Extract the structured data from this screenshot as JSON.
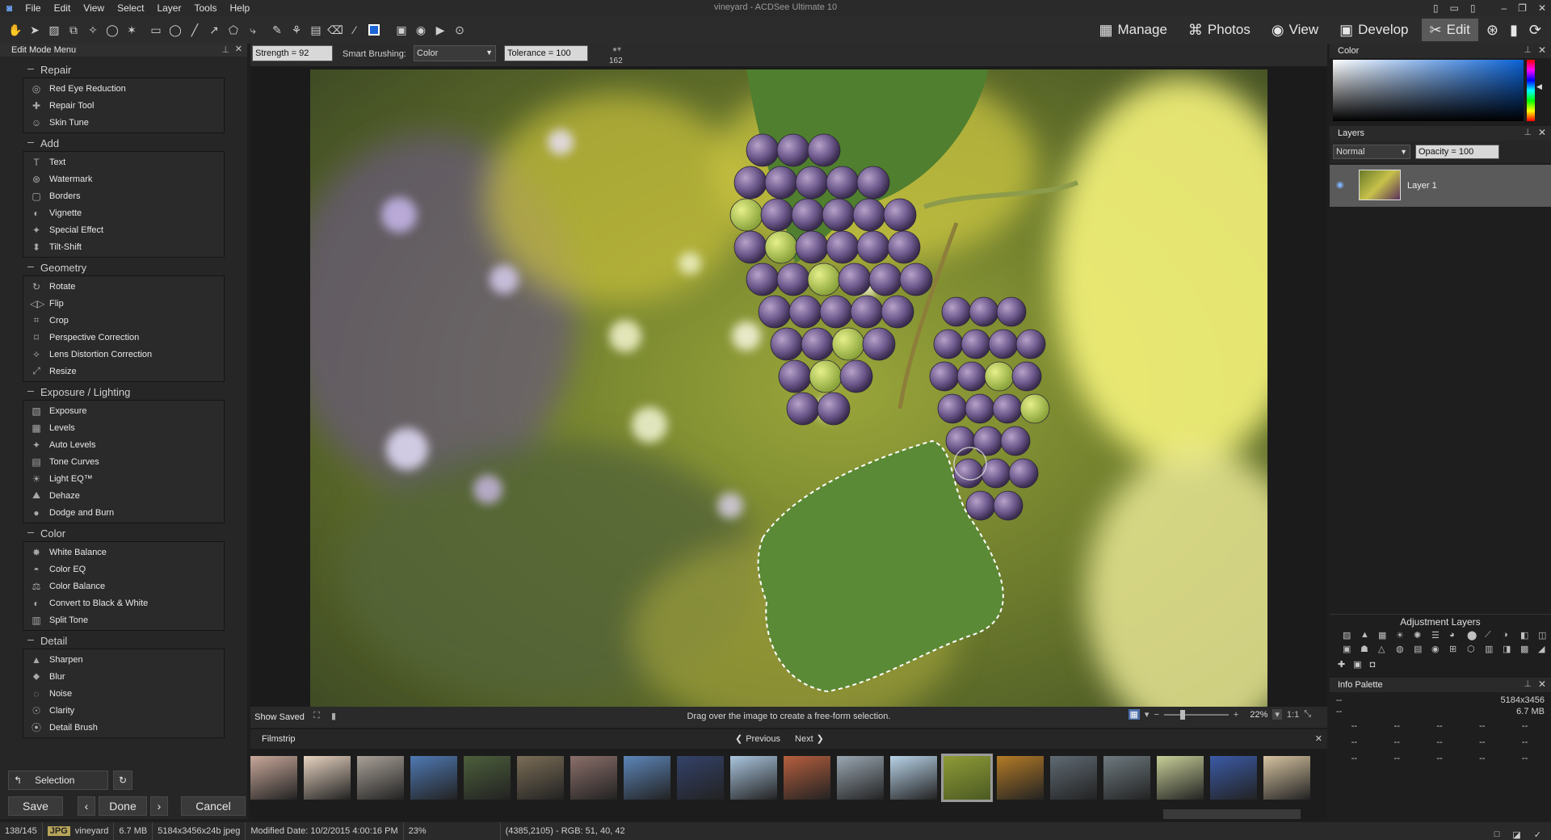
{
  "app": {
    "title": "vineyard - ACDSee Ultimate 10",
    "menu": [
      "File",
      "Edit",
      "View",
      "Select",
      "Layer",
      "Tools",
      "Help"
    ]
  },
  "modes": [
    {
      "label": "Manage",
      "icon": "grid-icon"
    },
    {
      "label": "Photos",
      "icon": "photos-icon"
    },
    {
      "label": "View",
      "icon": "eye-icon"
    },
    {
      "label": "Develop",
      "icon": "develop-icon"
    },
    {
      "label": "Edit",
      "icon": "edit-icon",
      "active": true
    }
  ],
  "left": {
    "title": "Edit Mode Menu",
    "groups": [
      {
        "name": "Repair",
        "items": [
          "Red Eye Reduction",
          "Repair Tool",
          "Skin Tune"
        ]
      },
      {
        "name": "Add",
        "items": [
          "Text",
          "Watermark",
          "Borders",
          "Vignette",
          "Special Effect",
          "Tilt-Shift"
        ]
      },
      {
        "name": "Geometry",
        "items": [
          "Rotate",
          "Flip",
          "Crop",
          "Perspective Correction",
          "Lens Distortion Correction",
          "Resize"
        ]
      },
      {
        "name": "Exposure / Lighting",
        "items": [
          "Exposure",
          "Levels",
          "Auto Levels",
          "Tone Curves",
          "Light EQ™",
          "Dehaze",
          "Dodge and Burn"
        ]
      },
      {
        "name": "Color",
        "items": [
          "White Balance",
          "Color EQ",
          "Color Balance",
          "Convert to Black & White",
          "Split Tone"
        ]
      },
      {
        "name": "Detail",
        "items": [
          "Sharpen",
          "Blur",
          "Noise",
          "Clarity",
          "Detail Brush"
        ]
      }
    ],
    "selection_label": "Selection",
    "save_label": "Save",
    "done_label": "Done",
    "cancel_label": "Cancel"
  },
  "options": {
    "strength": "Strength = 92",
    "smart_brushing_label": "Smart Brushing:",
    "smart_brushing_value": "Color",
    "tolerance": "Tolerance = 100",
    "brush_size": "162"
  },
  "canvas": {
    "show_saved": "Show Saved",
    "hint": "Drag over the image to create a free-form selection.",
    "zoom": "22%",
    "ratio": "1:1"
  },
  "filmstrip": {
    "title": "Filmstrip",
    "previous": "Previous",
    "next": "Next",
    "thumb_colors": [
      "#c9a89a",
      "#e7d3c0",
      "#a9a198",
      "#4f79b3",
      "#4c5f3b",
      "#7b6d56",
      "#8b6f6a",
      "#5d86b9",
      "#34426a",
      "#aac5de",
      "#b65f3e",
      "#9aa7b2",
      "#b9d4e9",
      "#8f9b37",
      "#b47b27",
      "#5f6a73",
      "#6e7a7f",
      "#c8cf98",
      "#3b5aa6",
      "#d6c3a0"
    ]
  },
  "right": {
    "color_title": "Color",
    "layers_title": "Layers",
    "blend_mode": "Normal",
    "opacity": "Opacity = 100",
    "layer_name": "Layer 1",
    "adjustment_title": "Adjustment Layers",
    "info_title": "Info Palette",
    "info_dims": "5184x3456",
    "info_size": "6.7 MB",
    "info_dash": "--"
  },
  "status": {
    "index": "138/145",
    "format": "JPG",
    "name": "vineyard",
    "size": "6.7 MB",
    "dims": "5184x3456x24b jpeg",
    "modified": "Modified Date: 10/2/2015 4:00:16 PM",
    "zoom": "23%",
    "pixel": "(4385,2105) - RGB: 51, 40, 42"
  }
}
